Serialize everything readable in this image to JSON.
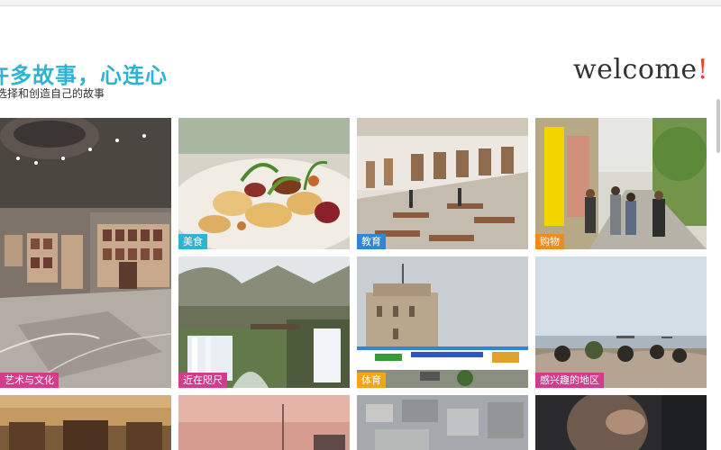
{
  "header": {
    "headline": "许多故事，心连心",
    "subhead": "选择和创造自己的故事",
    "welcome_text": "welcome",
    "welcome_mark": "!"
  },
  "tiles": [
    {
      "label": "",
      "tag_color": "",
      "icon": "museum-hall-photo"
    },
    {
      "label": "美食",
      "tag_color": "#2fb3d3",
      "icon": "food-photo"
    },
    {
      "label": "教育",
      "tag_color": "#2f86d6",
      "icon": "school-courtyard-photo"
    },
    {
      "label": "购物",
      "tag_color": "#f08a1c",
      "icon": "shopping-street-photo"
    },
    {
      "label": "艺术与文化",
      "tag_color": "#d43b8c",
      "icon": "museum-hall-photo"
    },
    {
      "label": "近在咫尺",
      "tag_color": "#d43b8c",
      "icon": "waterfall-photo"
    },
    {
      "label": "体育",
      "tag_color": "#f2a515",
      "icon": "white-tower-photo"
    },
    {
      "label": "感兴趣的地区",
      "tag_color": "#d43b8c",
      "icon": "seafront-photo"
    },
    {
      "label": "",
      "tag_color": "",
      "icon": "ballroom-photo"
    },
    {
      "label": "",
      "tag_color": "",
      "icon": "sunset-photo"
    },
    {
      "label": "",
      "tag_color": "",
      "icon": "city-aerial-photo"
    },
    {
      "label": "",
      "tag_color": "",
      "icon": "portrait-photo"
    }
  ]
}
